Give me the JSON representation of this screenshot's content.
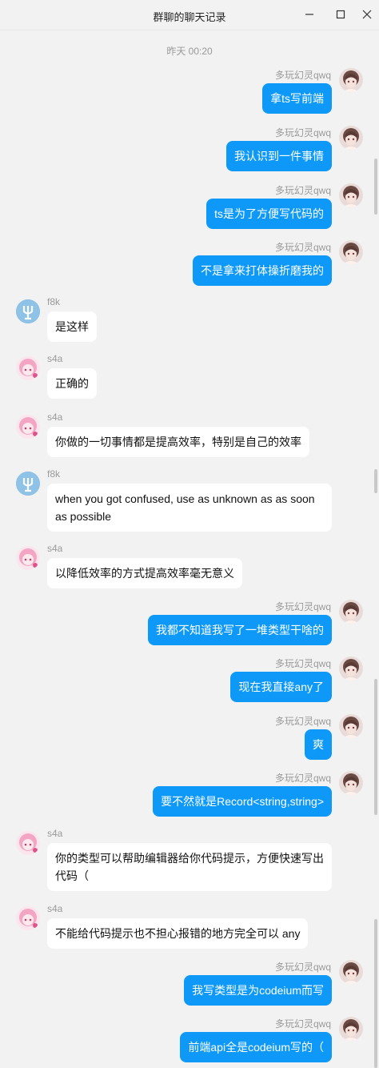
{
  "window": {
    "title": "群聊的聊天记录",
    "controls": [
      "minimize-icon",
      "maximize-icon",
      "close-icon"
    ]
  },
  "timestamp": "昨天 00:20",
  "colors": {
    "my_bubble": "#0e99f8",
    "their_bubble": "#ffffff",
    "background": "#f2f2f2"
  },
  "messages": [
    {
      "sender": "多玩幻灵qwq",
      "side": "me",
      "text": "拿ts写前端"
    },
    {
      "sender": "多玩幻灵qwq",
      "side": "me",
      "text": "我认识到一件事情"
    },
    {
      "sender": "多玩幻灵qwq",
      "side": "me",
      "text": "ts是为了方便写代码的"
    },
    {
      "sender": "多玩幻灵qwq",
      "side": "me",
      "text": "不是拿来打体操折磨我的"
    },
    {
      "sender": "f8k",
      "side": "them",
      "text": "是这样"
    },
    {
      "sender": "s4a",
      "side": "them",
      "text": "正确的"
    },
    {
      "sender": "s4a",
      "side": "them",
      "text": "你做的一切事情都是提高效率，特别是自己的效率"
    },
    {
      "sender": "f8k",
      "side": "them",
      "text": "when you got confused, use as unknown as as soon as possible"
    },
    {
      "sender": "s4a",
      "side": "them",
      "text": "以降低效率的方式提高效率毫无意义"
    },
    {
      "sender": "多玩幻灵qwq",
      "side": "me",
      "text": "我都不知道我写了一堆类型干啥的"
    },
    {
      "sender": "多玩幻灵qwq",
      "side": "me",
      "text": "现在我直接any了"
    },
    {
      "sender": "多玩幻灵qwq",
      "side": "me",
      "text": "爽"
    },
    {
      "sender": "多玩幻灵qwq",
      "side": "me",
      "text": "要不然就是Record<string,string>"
    },
    {
      "sender": "s4a",
      "side": "them",
      "text": "你的类型可以帮助编辑器给你代码提示，方便快速写出代码（"
    },
    {
      "sender": "s4a",
      "side": "them",
      "text": "不能给代码提示也不担心报错的地方完全可以 any"
    },
    {
      "sender": "多玩幻灵qwq",
      "side": "me",
      "text": "我写类型是为codeium而写"
    },
    {
      "sender": "多玩幻灵qwq",
      "side": "me",
      "text": "前端api全是codeium写的（"
    }
  ]
}
